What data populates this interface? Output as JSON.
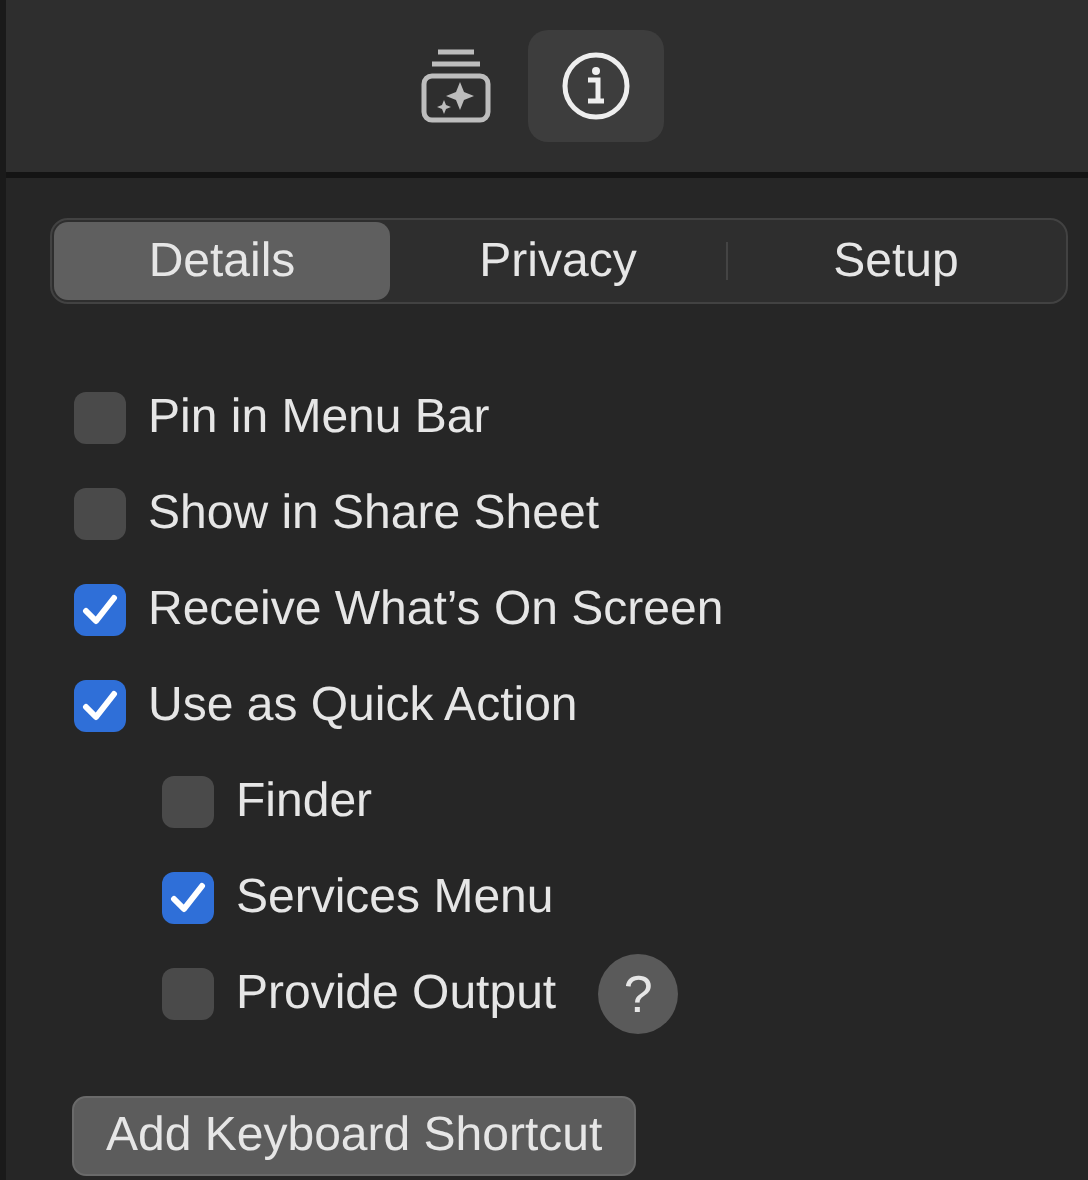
{
  "toolbar": {
    "items": [
      {
        "kind": "gallery",
        "selected": false
      },
      {
        "kind": "info",
        "selected": true
      }
    ]
  },
  "tabs": [
    {
      "label": "Details",
      "selected": true
    },
    {
      "label": "Privacy",
      "selected": false
    },
    {
      "label": "Setup",
      "selected": false
    }
  ],
  "options": [
    {
      "label": "Pin in Menu Bar",
      "checked": false
    },
    {
      "label": "Show in Share Sheet",
      "checked": false
    },
    {
      "label": "Receive What’s On Screen",
      "checked": true
    },
    {
      "label": "Use as Quick Action",
      "checked": true,
      "children": [
        {
          "label": "Finder",
          "checked": false
        },
        {
          "label": "Services Menu",
          "checked": true
        },
        {
          "label": "Provide Output",
          "checked": false,
          "help": "?"
        }
      ]
    }
  ],
  "button": "Add Keyboard Shortcut"
}
